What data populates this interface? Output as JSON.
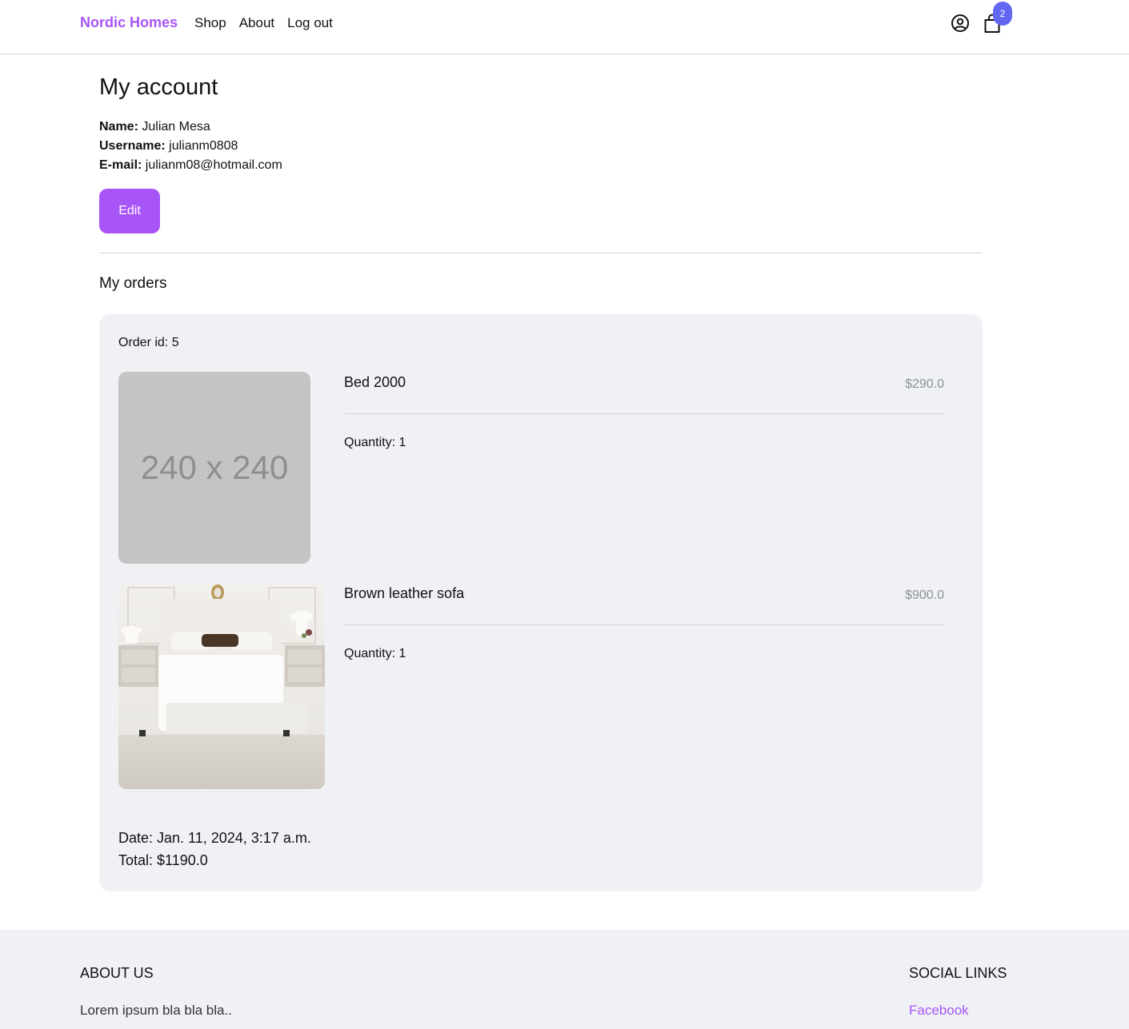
{
  "header": {
    "brand": "Nordic Homes",
    "nav": [
      "Shop",
      "About",
      "Log out"
    ],
    "cart_count": "2"
  },
  "account": {
    "title": "My account",
    "name_label": "Name:",
    "name": "Julian Mesa",
    "username_label": "Username:",
    "username": "julianm0808",
    "email_label": "E-mail:",
    "email": "julianm08@hotmail.com",
    "edit_label": "Edit"
  },
  "orders": {
    "title": "My orders",
    "list": [
      {
        "order_id": "Order id: 5",
        "items": [
          {
            "name": "Bed 2000",
            "price": "$290.0",
            "quantity": "Quantity: 1",
            "image_text": "240 x 240"
          },
          {
            "name": "Brown leather sofa",
            "price": "$900.0",
            "quantity": "Quantity: 1"
          }
        ],
        "date": "Date: Jan. 11, 2024, 3:17 a.m.",
        "total": "Total: $1190.0"
      }
    ]
  },
  "footer": {
    "about_heading": "ABOUT US",
    "about_text": "Lorem ipsum bla bla bla..",
    "social_heading": "SOCIAL LINKS",
    "social_links": [
      "Facebook"
    ]
  },
  "colors": {
    "accent": "#a855f7",
    "badge": "#6366f1",
    "card_bg": "#f0f1f5"
  }
}
